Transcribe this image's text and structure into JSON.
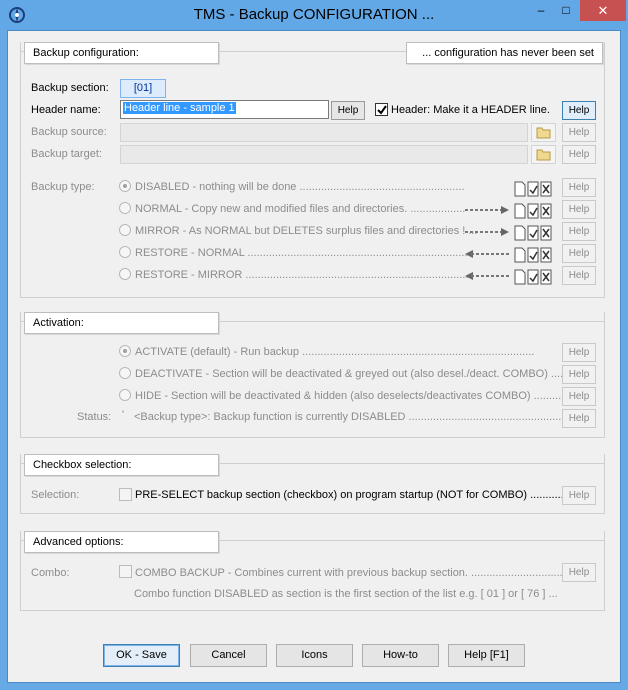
{
  "window": {
    "title": "TMS - Backup CONFIGURATION ...",
    "minimize": "–",
    "maximize": "□",
    "close": "✕"
  },
  "backup_config": {
    "title": "Backup configuration:",
    "status": "... configuration has never been set",
    "section_label": "Backup section:",
    "section_value": "[01]",
    "header_label": "Header name:",
    "header_value": "Header line - sample 1",
    "header_help": "Help",
    "header_checkbox_label": "Header: Make it a HEADER line.",
    "header_checkbox_help": "Help",
    "source_label": "Backup source:",
    "source_help": "Help",
    "target_label": "Backup target:",
    "target_help": "Help",
    "type_label": "Backup type:",
    "types": [
      {
        "label": "DISABLED - nothing will be done ......................................................",
        "help": "Help",
        "checked": true,
        "arrow": "none"
      },
      {
        "label": "NORMAL - Copy new and modified files and directories. ..................",
        "help": "Help",
        "checked": false,
        "arrow": "right"
      },
      {
        "label": "MIRROR - As NORMAL but DELETES surplus files and directories ! ...",
        "help": "Help",
        "checked": false,
        "arrow": "right"
      },
      {
        "label": "RESTORE - NORMAL ........................................................................",
        "help": "Help",
        "checked": false,
        "arrow": "left"
      },
      {
        "label": "RESTORE - MIRROR .........................................................................",
        "help": "Help",
        "checked": false,
        "arrow": "left"
      }
    ]
  },
  "activation": {
    "title": "Activation:",
    "options": [
      {
        "label": "ACTIVATE (default) - Run backup ............................................................................",
        "help": "Help",
        "checked": true
      },
      {
        "label": "DEACTIVATE - Section will be deactivated & greyed out (also desel./deact. COMBO) ....",
        "help": "Help",
        "checked": false
      },
      {
        "label": "HIDE - Section will be deactivated & hidden (also deselects/deactivates COMBO) ..........",
        "help": "Help",
        "checked": false
      }
    ],
    "status_label": "Status:",
    "status_marker": "'",
    "status_text": "<Backup type>: Backup function is currently DISABLED ....................................................",
    "status_help": "Help"
  },
  "checkbox_selection": {
    "title": "Checkbox selection:",
    "label": "Selection:",
    "text": "PRE-SELECT backup section (checkbox) on program startup (NOT for COMBO) ..............",
    "help": "Help"
  },
  "advanced": {
    "title": "Advanced options:",
    "label": "Combo:",
    "text": "COMBO BACKUP - Combines current with previous backup section. ..............................",
    "help": "Help",
    "note": "Combo function DISABLED as section is the first section of the list e.g. [ 01 ] or [ 76 ] ..."
  },
  "buttons": {
    "ok": "OK - Save",
    "cancel": "Cancel",
    "icons": "Icons",
    "howto": "How-to",
    "help": "Help [F1]"
  },
  "colors": {
    "titlebar": "#62a8e6",
    "close": "#c75050",
    "selection": "#3399ff"
  }
}
